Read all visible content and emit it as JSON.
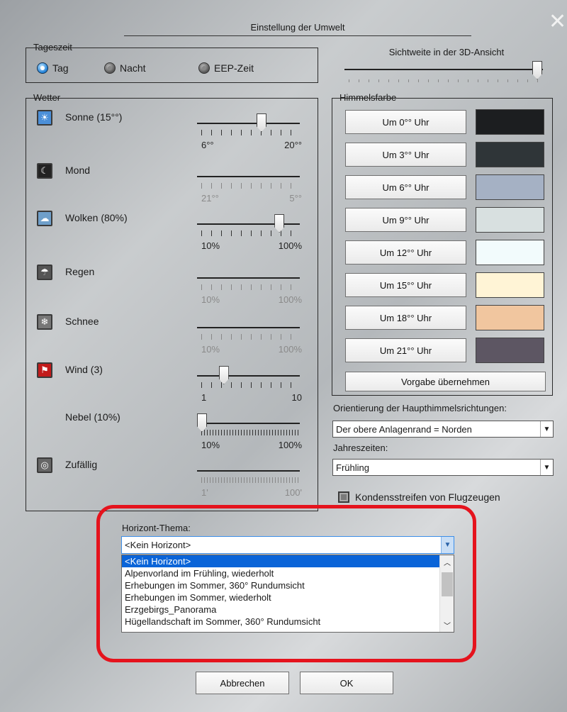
{
  "dialog": {
    "title": "Einstellung der Umwelt"
  },
  "tageszeit": {
    "legend": "Tageszeit",
    "options": [
      {
        "label": "Tag",
        "selected": true
      },
      {
        "label": "Nacht",
        "selected": false
      },
      {
        "label": "EEP-Zeit",
        "selected": false
      }
    ]
  },
  "sichtweite": {
    "label": "Sichtweite in der 3D-Ansicht",
    "level": 1.0
  },
  "wetter": {
    "legend": "Wetter",
    "rows": [
      {
        "label": "Sonne (15°°)",
        "icon": "sun-icon",
        "min": "6°°",
        "max": "20°°",
        "value": 0.6,
        "enabled": true
      },
      {
        "label": "Mond",
        "icon": "moon-icon",
        "min": "21°°",
        "max": "5°°",
        "enabled": false
      },
      {
        "label": "Wolken (80%)",
        "icon": "cloud-icon",
        "min": "10%",
        "max": "100%",
        "value": 0.78,
        "enabled": true
      },
      {
        "label": "Regen",
        "icon": "rain-icon",
        "min": "10%",
        "max": "100%",
        "enabled": false
      },
      {
        "label": "Schnee",
        "icon": "snow-icon",
        "min": "10%",
        "max": "100%",
        "enabled": false
      },
      {
        "label": "Wind (3)",
        "icon": "wind-icon",
        "min": "1",
        "max": "10",
        "value": 0.22,
        "enabled": true
      },
      {
        "label": "Nebel (10%)",
        "icon": "",
        "min": "10%",
        "max": "100%",
        "value": 0.0,
        "enabled": true
      },
      {
        "label": "Zufällig",
        "icon": "random-icon",
        "min": "1'",
        "max": "100'",
        "enabled": false
      }
    ]
  },
  "himmelsfarbe": {
    "legend": "Himmelsfarbe",
    "rows": [
      {
        "label": "Um 0°° Uhr",
        "color": "#1c1e20"
      },
      {
        "label": "Um 3°° Uhr",
        "color": "#2f3538"
      },
      {
        "label": "Um 6°° Uhr",
        "color": "#a5b1c4"
      },
      {
        "label": "Um 9°° Uhr",
        "color": "#d8e0e0"
      },
      {
        "label": "Um 12°° Uhr",
        "color": "#f2fbfc"
      },
      {
        "label": "Um 15°° Uhr",
        "color": "#fff4d6"
      },
      {
        "label": "Um 18°° Uhr",
        "color": "#f1c69f"
      },
      {
        "label": "Um 21°° Uhr",
        "color": "#5d5663"
      }
    ],
    "reset": "Vorgabe übernehmen"
  },
  "orientierung": {
    "label": "Orientierung der Haupthimmelsrichtungen:",
    "value": "Der obere Anlagenrand = Norden"
  },
  "jahreszeiten": {
    "label": "Jahreszeiten:",
    "value": "Frühling"
  },
  "kondens": {
    "label": "Kondensstreifen von Flugzeugen",
    "checked": false
  },
  "horizont": {
    "label": "Horizont-Thema:",
    "value": "<Kein Horizont>",
    "options": [
      "<Kein Horizont>",
      "Alpenvorland im Frühling, wiederholt",
      "Erhebungen im Sommer, 360° Rundumsicht",
      "Erhebungen im Sommer, wiederholt",
      "Erzgebirgs_Panorama",
      "Hügellandschaft im Sommer, 360° Rundumsicht"
    ]
  },
  "buttons": {
    "cancel": "Abbrechen",
    "ok": "OK"
  }
}
